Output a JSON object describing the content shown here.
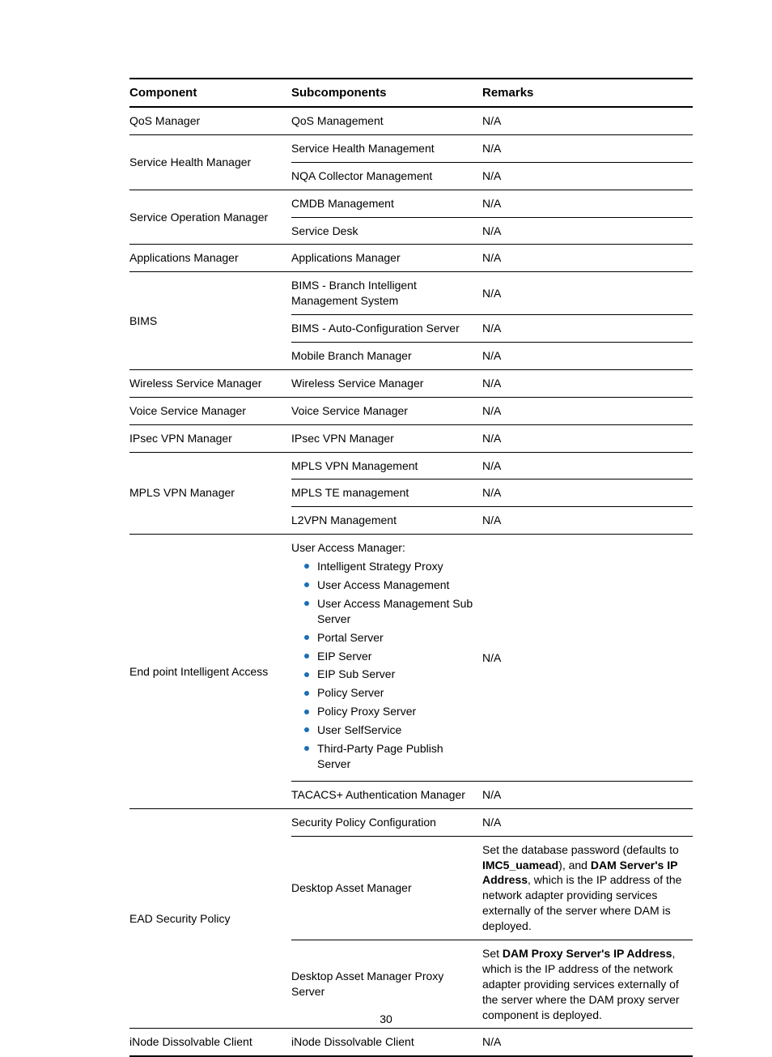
{
  "page_number": "30",
  "headers": {
    "c1": "Component",
    "c2": "Subcomponents",
    "c3": "Remarks"
  },
  "rows": [
    {
      "component": "QoS Manager",
      "sub": "QoS Management",
      "rem": "N/A",
      "rowspan": 1
    },
    {
      "component": "Service Health Manager",
      "rowspan": 2,
      "cells": [
        {
          "sub": "Service Health Management",
          "rem": "N/A"
        },
        {
          "sub": "NQA Collector Management",
          "rem": "N/A"
        }
      ]
    },
    {
      "component": "Service Operation Manager",
      "rowspan": 2,
      "cells": [
        {
          "sub": "CMDB Management",
          "rem": "N/A"
        },
        {
          "sub": "Service Desk",
          "rem": "N/A"
        }
      ]
    },
    {
      "component": "Applications Manager",
      "sub": "Applications Manager",
      "rem": "N/A",
      "rowspan": 1
    },
    {
      "component": "BIMS",
      "rowspan": 3,
      "cells": [
        {
          "sub": "BIMS - Branch Intelligent Management System",
          "rem": "N/A"
        },
        {
          "sub": "BIMS - Auto-Configuration Server",
          "rem": "N/A"
        },
        {
          "sub": "Mobile Branch Manager",
          "rem": "N/A"
        }
      ]
    },
    {
      "component": "Wireless Service Manager",
      "sub": "Wireless Service Manager",
      "rem": "N/A",
      "rowspan": 1
    },
    {
      "component": "Voice Service Manager",
      "sub": "Voice Service Manager",
      "rem": "N/A",
      "rowspan": 1
    },
    {
      "component": "IPsec VPN Manager",
      "sub": "IPsec VPN Manager",
      "rem": "N/A",
      "rowspan": 1
    },
    {
      "component": "MPLS VPN Manager",
      "rowspan": 3,
      "cells": [
        {
          "sub": "MPLS VPN Management",
          "rem": "N/A"
        },
        {
          "sub": "MPLS TE management",
          "rem": "N/A"
        },
        {
          "sub": "L2VPN Management",
          "rem": "N/A"
        }
      ]
    },
    {
      "component": "End point Intelligent Access",
      "rowspan": 2,
      "cells": [
        {
          "sub_list_header": "User Access Manager:",
          "sub_list": [
            "Intelligent Strategy Proxy",
            "User Access Management",
            "User Access Management Sub Server",
            "Portal Server",
            "EIP Server",
            "EIP Sub Server",
            "Policy Server",
            "Policy Proxy Server",
            "User SelfService",
            "Third-Party Page Publish Server"
          ],
          "rem": "N/A"
        },
        {
          "sub": "TACACS+ Authentication Manager",
          "rem": "N/A"
        }
      ]
    },
    {
      "component": "EAD Security Policy",
      "rowspan": 3,
      "cells": [
        {
          "sub": "Security Policy Configuration",
          "rem": "N/A"
        },
        {
          "sub": "Desktop Asset Manager",
          "rem_rich": [
            {
              "t": "Set the database password (defaults to "
            },
            {
              "b": "IMC5_uamead"
            },
            {
              "t": "), and "
            },
            {
              "b": "DAM Server's IP Address"
            },
            {
              "t": ", which is the IP address of the network adapter providing services externally of the server where DAM is deployed."
            }
          ]
        },
        {
          "sub": "Desktop Asset Manager Proxy Server",
          "rem_rich": [
            {
              "t": "Set "
            },
            {
              "b": "DAM Proxy Server's IP Address"
            },
            {
              "t": ", which is the IP address of the network adapter providing services externally of the server where the DAM proxy server component is deployed."
            }
          ]
        }
      ]
    },
    {
      "component": "iNode Dissolvable Client",
      "sub": "iNode Dissolvable Client",
      "rem": "N/A",
      "rowspan": 1
    }
  ]
}
